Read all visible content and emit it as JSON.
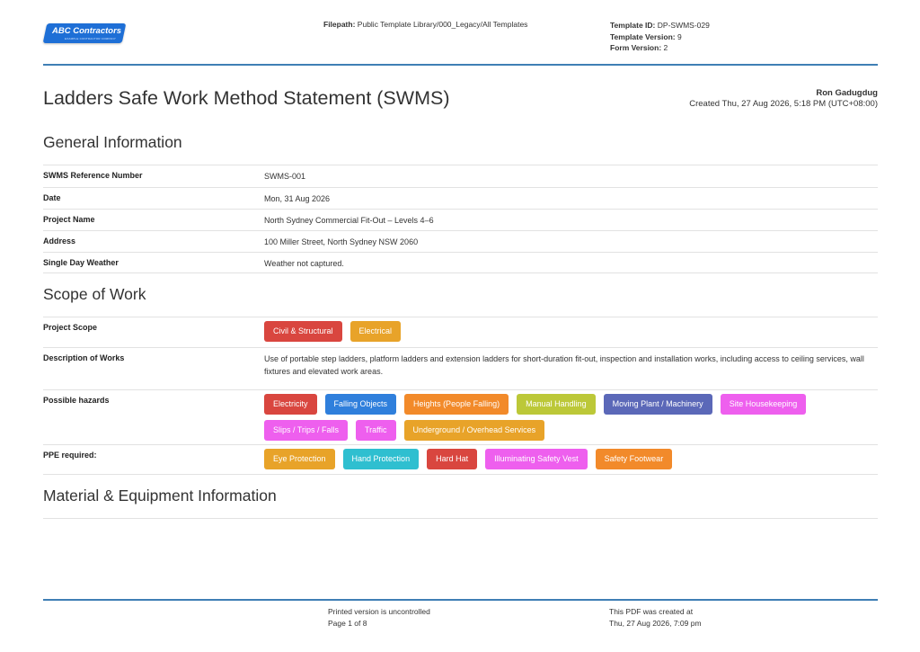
{
  "header": {
    "logo_text": "ABC Contractors",
    "logo_sub": "EXAMPLE CONTRACTOR COMPANY",
    "filepath_label": "Filepath:",
    "filepath_value": "Public Template Library/000_Legacy/All Templates",
    "template_id_label": "Template ID:",
    "template_id_value": "DP-SWMS-029",
    "template_version_label": "Template Version:",
    "template_version_value": "9",
    "form_version_label": "Form Version:",
    "form_version_value": "2"
  },
  "document": {
    "title": "Ladders Safe Work Method Statement (SWMS)",
    "author": "Ron Gadugdug",
    "created": "Created Thu, 27 Aug 2026, 5:18 PM (UTC+08:00)"
  },
  "general": {
    "title": "General Information",
    "rows": [
      {
        "label": "SWMS Reference Number",
        "value": "SWMS-001"
      },
      {
        "label": "Date",
        "value": "Mon, 31 Aug 2026"
      },
      {
        "label": "Project Name",
        "value": "North Sydney Commercial Fit-Out – Levels 4–6"
      },
      {
        "label": "Address",
        "value": "100 Miller Street, North Sydney NSW 2060"
      },
      {
        "label": "Single Day Weather",
        "value": "Weather not captured."
      }
    ]
  },
  "scope": {
    "title": "Scope of Work",
    "project_scope_label": "Project Scope",
    "project_scope": [
      {
        "text": "Civil & Structural",
        "color": "#d9463f"
      },
      {
        "text": "Electrical",
        "color": "#e8a329"
      }
    ],
    "description_label": "Description of Works",
    "description": "Use of portable step ladders, platform ladders and extension ladders for short-duration fit-out, inspection and installation works, including access to ceiling services, wall fixtures and elevated work areas.",
    "hazards_label": "Possible hazards",
    "hazards": [
      {
        "text": "Electricity",
        "color": "#d9463f"
      },
      {
        "text": "Falling Objects",
        "color": "#2f7fdc"
      },
      {
        "text": "Heights (People Falling)",
        "color": "#f28a2a"
      },
      {
        "text": "Manual Handling",
        "color": "#bcc838"
      },
      {
        "text": "Moving Plant / Machinery",
        "color": "#5b68b8"
      },
      {
        "text": "Site Housekeeping",
        "color": "#ee5fee"
      },
      {
        "text": "Slips / Trips / Falls",
        "color": "#ee5fee"
      },
      {
        "text": "Traffic",
        "color": "#ee5fee"
      },
      {
        "text": "Underground / Overhead Services",
        "color": "#e8a329"
      }
    ],
    "ppe_label": "PPE required:",
    "ppe": [
      {
        "text": "Eye Protection",
        "color": "#e8a329"
      },
      {
        "text": "Hand Protection",
        "color": "#2fbfd0"
      },
      {
        "text": "Hard Hat",
        "color": "#d9463f"
      },
      {
        "text": "Illuminating Safety Vest",
        "color": "#ee5fee"
      },
      {
        "text": "Safety Footwear",
        "color": "#f28a2a"
      }
    ]
  },
  "material": {
    "title": "Material & Equipment Information"
  },
  "footer": {
    "left_line1": "Printed version is uncontrolled",
    "left_line2": "Page 1 of 8",
    "right_line1": "This PDF was created at",
    "right_line2": "Thu, 27 Aug 2026, 7:09 pm"
  }
}
